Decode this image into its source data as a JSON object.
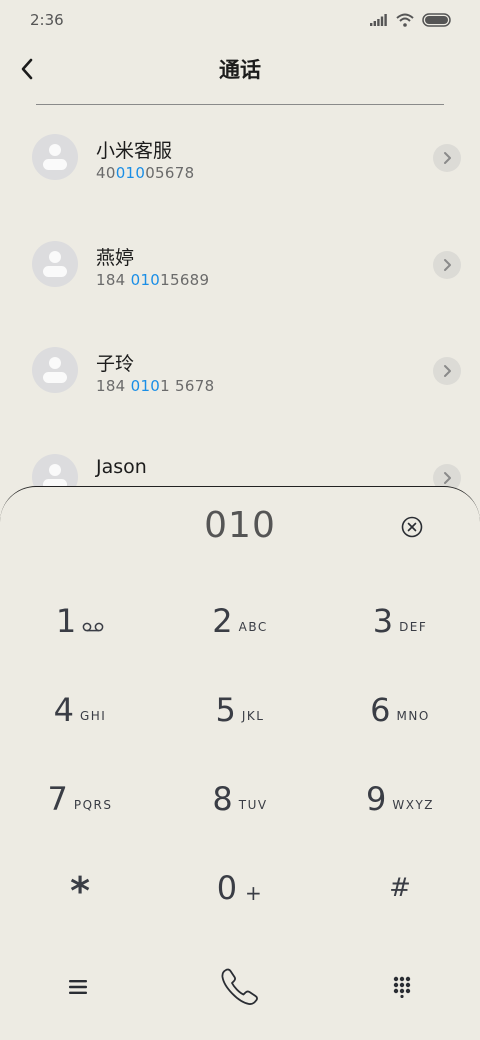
{
  "status_bar": {
    "time": "2:36",
    "icons": [
      "signal-icon",
      "wifi-icon",
      "battery-icon"
    ]
  },
  "header": {
    "title": "通话",
    "back_icon": "chevron-left-icon"
  },
  "contacts": [
    {
      "name": "小米客服",
      "number_pre": "40",
      "number_hl": "010",
      "number_post": "05678"
    },
    {
      "name": "燕婷",
      "number_pre": "184 ",
      "number_hl": "010",
      "number_post": "15689"
    },
    {
      "name": "子玲",
      "number_pre": "184 ",
      "number_hl": "010",
      "number_post": "1 5678"
    },
    {
      "name": "Jason",
      "number_pre": "",
      "number_hl": "",
      "number_post": ""
    }
  ],
  "dialer": {
    "input_value": "010",
    "keys": [
      {
        "digit": "1",
        "letters": "",
        "icon": "voicemail-icon"
      },
      {
        "digit": "2",
        "letters": "ABC"
      },
      {
        "digit": "3",
        "letters": "DEF"
      },
      {
        "digit": "4",
        "letters": "GHI"
      },
      {
        "digit": "5",
        "letters": "JKL"
      },
      {
        "digit": "6",
        "letters": "MNO"
      },
      {
        "digit": "7",
        "letters": "PQRS"
      },
      {
        "digit": "8",
        "letters": "TUV"
      },
      {
        "digit": "9",
        "letters": "WXYZ"
      },
      {
        "digit": "*",
        "letters": ""
      },
      {
        "digit": "0",
        "letters": "+"
      },
      {
        "digit": "#",
        "letters": ""
      }
    ],
    "bottom": {
      "menu_icon": "menu-icon",
      "call_icon": "phone-icon",
      "keypad_icon": "dialpad-icon"
    }
  },
  "colors": {
    "background": "#edebe3",
    "highlight": "#1a8ee6",
    "text": "#2a2d33"
  }
}
